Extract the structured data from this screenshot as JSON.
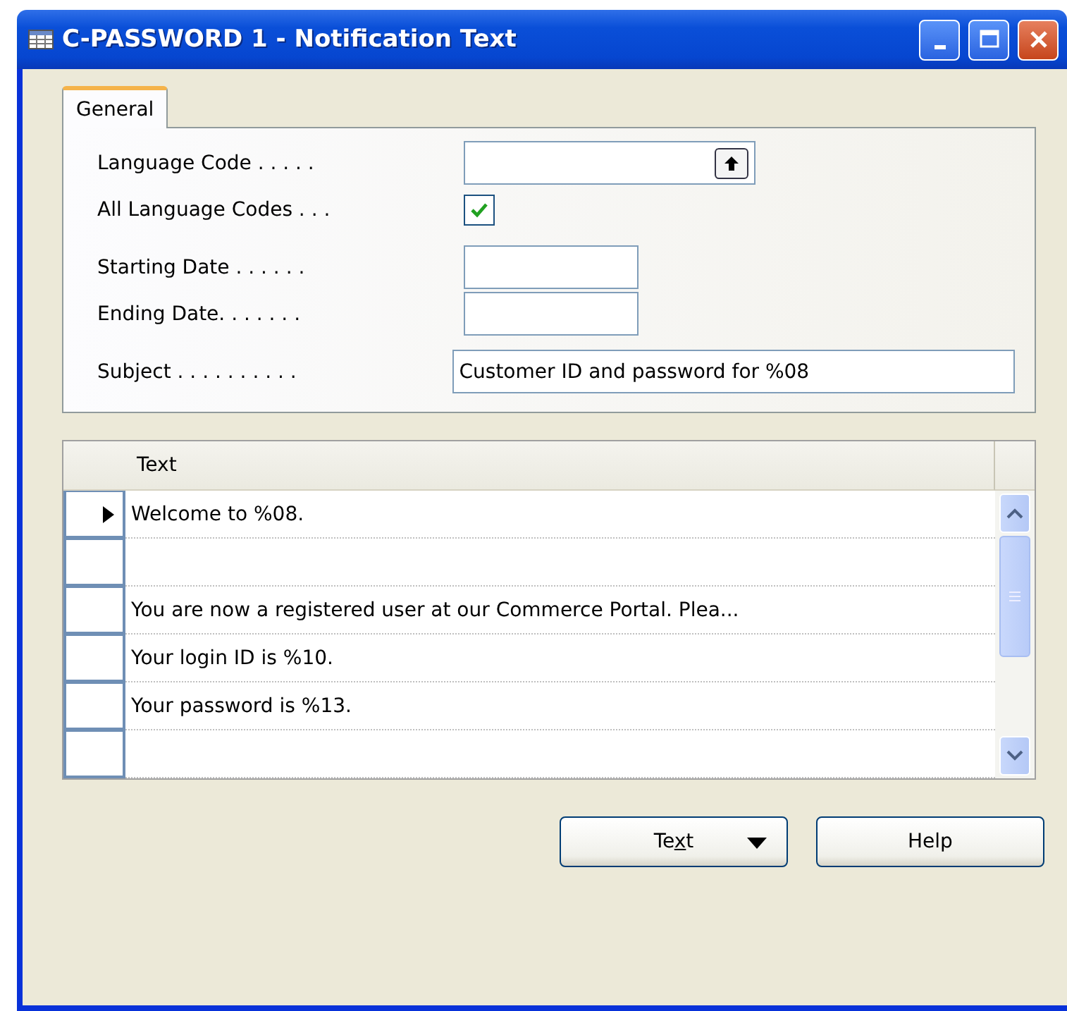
{
  "window": {
    "title": "C-PASSWORD 1 - Notification Text"
  },
  "tabs": [
    {
      "label": "General",
      "selected": true
    }
  ],
  "fields": [
    {
      "label": "Language Code . . . . .",
      "kind": "lookup"
    },
    {
      "label": "All Language Codes . . .",
      "kind": "checkbox",
      "checked": true
    },
    {
      "label": "Starting Date . . . . . .",
      "kind": "date"
    },
    {
      "label": "Ending Date. . . . . . .",
      "kind": "date"
    },
    {
      "label": "Subject . . . . . . . . . .",
      "kind": "text",
      "value": "Customer ID and password for %08"
    }
  ],
  "table": {
    "columns": [
      "Text"
    ],
    "rows": [
      {
        "text": "Welcome to %08.",
        "selected": true
      },
      {
        "text": "",
        "selected": false
      },
      {
        "text": "You are now a registered user at our Commerce Portal. Plea...",
        "selected": false
      },
      {
        "text": "Your login ID is %10.",
        "selected": false
      },
      {
        "text": "Your password is %13.",
        "selected": false
      },
      {
        "text": "",
        "selected": false
      }
    ]
  },
  "buttons": [
    {
      "label": [
        {
          "text": "Te",
          "underlined": false
        },
        {
          "text": "x",
          "underlined": true
        },
        {
          "text": "t",
          "underlined": false
        }
      ],
      "kind": "menu"
    },
    {
      "label": [
        {
          "text": "Help",
          "underlined": false
        }
      ],
      "kind": "plain"
    }
  ]
}
